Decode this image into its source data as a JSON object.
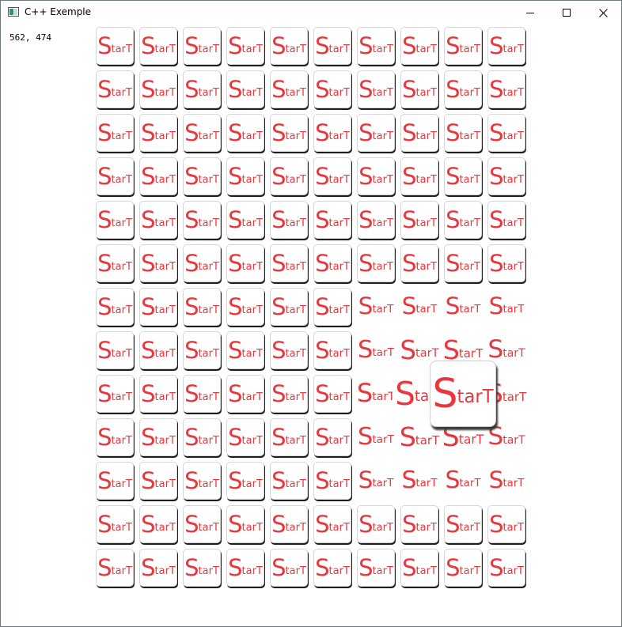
{
  "window": {
    "title": "C++ Exemple",
    "minimize_symbol": "minimize",
    "maximize_symbol": "maximize",
    "close_symbol": "close"
  },
  "cursor_readout": "562, 474",
  "tile": {
    "label_big": "S",
    "label_small": "tarT",
    "text_color": "#e8383d"
  },
  "grid": {
    "rows": 13,
    "cols": 10
  },
  "magnified": [
    {
      "row": 6,
      "col": 6,
      "scale": 1.02
    },
    {
      "row": 6,
      "col": 7,
      "scale": 1.02
    },
    {
      "row": 6,
      "col": 8,
      "scale": 1.02
    },
    {
      "row": 6,
      "col": 9,
      "scale": 1.02
    },
    {
      "row": 7,
      "col": 6,
      "scale": 1.05
    },
    {
      "row": 7,
      "col": 7,
      "scale": 1.12
    },
    {
      "row": 7,
      "col": 8,
      "scale": 1.15
    },
    {
      "row": 7,
      "col": 9,
      "scale": 1.08
    },
    {
      "row": 8,
      "col": 6,
      "scale": 1.1
    },
    {
      "row": 8,
      "col": 7,
      "scale": 1.4
    },
    {
      "row": 8,
      "col": 8,
      "scale": 1.75
    },
    {
      "row": 8,
      "col": 9,
      "scale": 1.15
    },
    {
      "row": 9,
      "col": 6,
      "scale": 1.05
    },
    {
      "row": 9,
      "col": 7,
      "scale": 1.15
    },
    {
      "row": 9,
      "col": 8,
      "scale": 1.2
    },
    {
      "row": 9,
      "col": 9,
      "scale": 1.08
    },
    {
      "row": 10,
      "col": 6,
      "scale": 1.02
    },
    {
      "row": 10,
      "col": 7,
      "scale": 1.03
    },
    {
      "row": 10,
      "col": 8,
      "scale": 1.03
    },
    {
      "row": 10,
      "col": 9,
      "scale": 1.02
    }
  ]
}
